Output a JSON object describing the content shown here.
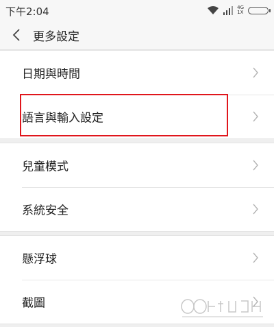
{
  "status_bar": {
    "time": "下午2:04",
    "network_labels": [
      "4G",
      "1X"
    ],
    "icons": [
      "wifi-icon",
      "signal-icon",
      "battery-icon"
    ]
  },
  "header": {
    "title": "更多設定",
    "back_icon": "chevron-left-icon"
  },
  "groups": [
    {
      "items": [
        {
          "label": "日期與時間"
        },
        {
          "label": "語言與輸入設定",
          "highlighted": true
        }
      ]
    },
    {
      "items": [
        {
          "label": "兒童模式"
        },
        {
          "label": "系統安全"
        }
      ]
    },
    {
      "items": [
        {
          "label": "懸浮球"
        },
        {
          "label": "截圖"
        }
      ]
    }
  ],
  "annotation": {
    "color": "#e0161c"
  },
  "colors": {
    "background": "#efefef",
    "surface": "#ffffff",
    "chevron": "#b3b3b3"
  }
}
